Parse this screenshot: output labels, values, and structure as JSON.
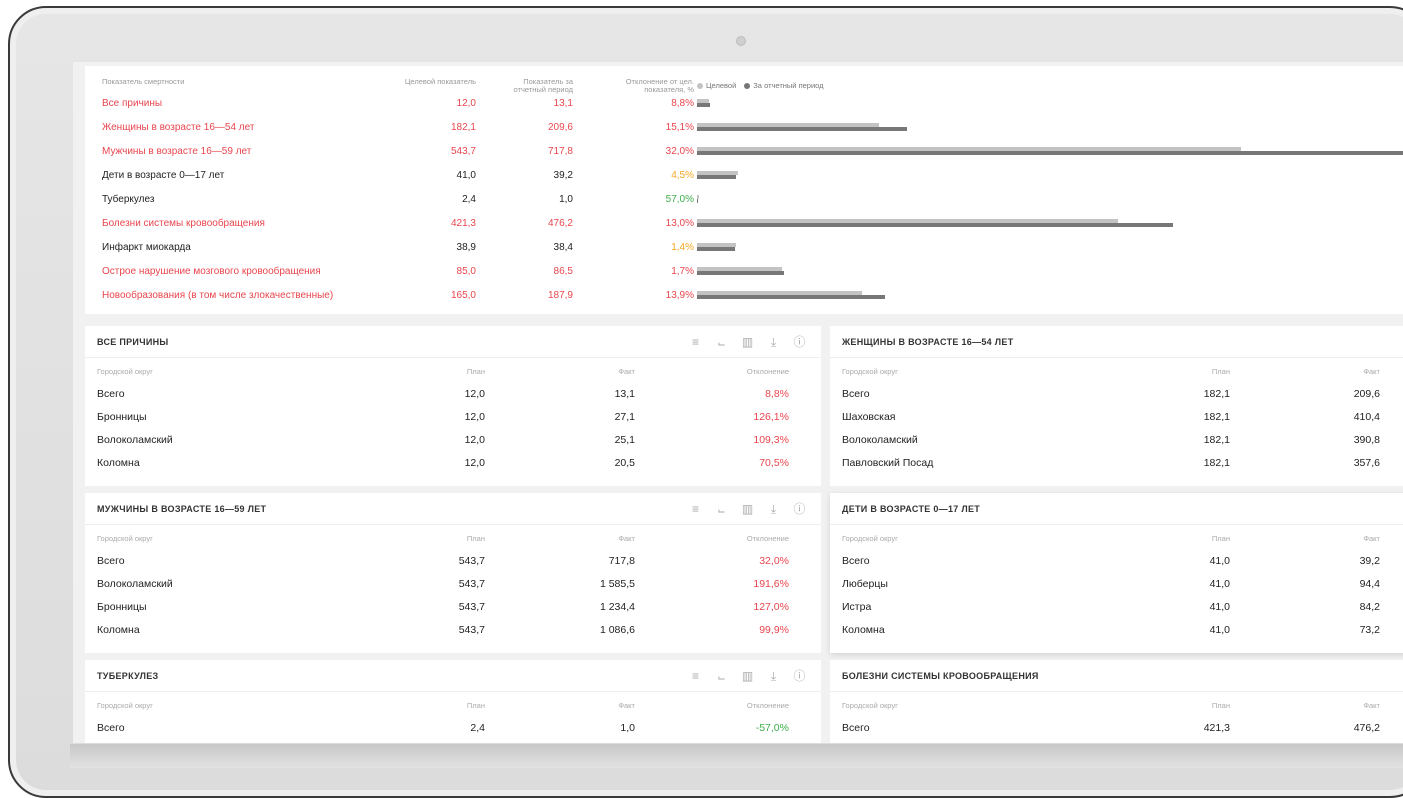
{
  "summary": {
    "headers": {
      "name": "Показатель смертности",
      "target": "Целевой показатель",
      "period": "Показатель за отчетный период",
      "deviation": "Отклонение от цел. показателя, %"
    },
    "legend": {
      "target": "Целевой",
      "period": "За отчетный период"
    },
    "rows": [
      {
        "name": "Все причины",
        "target": "12,0",
        "period": "13,1",
        "deviation": "8,8%",
        "target_value": 12.0,
        "period_value": 13.1
      },
      {
        "name": "Женщины в возрасте 16—54 лет",
        "target": "182,1",
        "period": "209,6",
        "deviation": "15,1%",
        "target_value": 182.1,
        "period_value": 209.6
      },
      {
        "name": "Мужчины в возрасте 16—59 лет",
        "target": "543,7",
        "period": "717,8",
        "deviation": "32,0%",
        "target_value": 543.7,
        "period_value": 717.8
      },
      {
        "name": "Дети в возрасте 0—17 лет",
        "target": "41,0",
        "period": "39,2",
        "deviation": "4,5%",
        "target_value": 41.0,
        "period_value": 39.2
      },
      {
        "name": "Туберкулез",
        "target": "2,4",
        "period": "1,0",
        "deviation": "57,0%",
        "target_value": 2.4,
        "period_value": 1.0
      },
      {
        "name": "Болезни системы кровообращения",
        "target": "421,3",
        "period": "476,2",
        "deviation": "13,0%",
        "target_value": 421.3,
        "period_value": 476.2
      },
      {
        "name": "Инфаркт миокарда",
        "target": "38,9",
        "period": "38,4",
        "deviation": "1,4%",
        "target_value": 38.9,
        "period_value": 38.4
      },
      {
        "name": "Острое нарушение мозгового кровообращения",
        "target": "85,0",
        "period": "86,5",
        "deviation": "1,7%",
        "target_value": 85.0,
        "period_value": 86.5
      },
      {
        "name": "Новообразования (в том числе злокачественные)",
        "target": "165,0",
        "period": "187,9",
        "deviation": "13,9%",
        "target_value": 165.0,
        "period_value": 187.9
      }
    ]
  },
  "colors": {
    "red": "#e8464e",
    "orange": "#f5a623",
    "green": "#3cae4a",
    "bar_target": "#c3c3c3",
    "bar_period": "#777777"
  },
  "icons": [
    "bar-chart-icon",
    "line-chart-icon",
    "map-icon",
    "download-icon",
    "info-icon"
  ],
  "cards": {
    "all_causes": {
      "title": "ВСЕ ПРИЧИНЫ",
      "headers": {
        "name": "Городской округ",
        "plan": "План",
        "fact": "Факт",
        "deviation": "Отклонение"
      },
      "rows": [
        {
          "name": "Всего",
          "plan": "12,0",
          "fact": "13,1",
          "deviation": "8,8%"
        },
        {
          "name": "Бронницы",
          "plan": "12,0",
          "fact": "27,1",
          "deviation": "126,1%"
        },
        {
          "name": "Волоколамский",
          "plan": "12,0",
          "fact": "25,1",
          "deviation": "109,3%"
        },
        {
          "name": "Коломна",
          "plan": "12,0",
          "fact": "20,5",
          "deviation": "70,5%"
        }
      ]
    },
    "women": {
      "title": "ЖЕНЩИНЫ В ВОЗРАСТЕ 16—54 ЛЕТ",
      "headers": {
        "name": "Городской округ",
        "plan": "План",
        "fact": "Факт"
      },
      "rows": [
        {
          "name": "Всего",
          "plan": "182,1",
          "fact": "209,6"
        },
        {
          "name": "Шаховская",
          "plan": "182,1",
          "fact": "410,4"
        },
        {
          "name": "Волоколамский",
          "plan": "182,1",
          "fact": "390,8"
        },
        {
          "name": "Павловский Посад",
          "plan": "182,1",
          "fact": "357,6"
        }
      ]
    },
    "men": {
      "title": "МУЖЧИНЫ В ВОЗРАСТЕ 16—59 ЛЕТ",
      "headers": {
        "name": "Городской округ",
        "plan": "План",
        "fact": "Факт",
        "deviation": "Отклонение"
      },
      "rows": [
        {
          "name": "Всего",
          "plan": "543,7",
          "fact": "717,8",
          "deviation": "32,0%"
        },
        {
          "name": "Волоколамский",
          "plan": "543,7",
          "fact": "1 585,5",
          "deviation": "191,6%"
        },
        {
          "name": "Бронницы",
          "plan": "543,7",
          "fact": "1 234,4",
          "deviation": "127,0%"
        },
        {
          "name": "Коломна",
          "plan": "543,7",
          "fact": "1 086,6",
          "deviation": "99,9%"
        }
      ]
    },
    "children": {
      "title": "ДЕТИ В ВОЗРАСТЕ 0—17 ЛЕТ",
      "headers": {
        "name": "Городской округ",
        "plan": "План",
        "fact": "Факт"
      },
      "rows": [
        {
          "name": "Всего",
          "plan": "41,0",
          "fact": "39,2"
        },
        {
          "name": "Люберцы",
          "plan": "41,0",
          "fact": "94,4"
        },
        {
          "name": "Истра",
          "plan": "41,0",
          "fact": "84,2"
        },
        {
          "name": "Коломна",
          "plan": "41,0",
          "fact": "73,2"
        }
      ]
    },
    "tuberculosis": {
      "title": "ТУБЕРКУЛЕЗ",
      "headers": {
        "name": "Городской округ",
        "plan": "План",
        "fact": "Факт",
        "deviation": "Отклонение"
      },
      "rows": [
        {
          "name": "Всего",
          "plan": "2,4",
          "fact": "1,0",
          "deviation": "-57,0%"
        }
      ]
    },
    "circulatory": {
      "title": "БОЛЕЗНИ СИСТЕМЫ КРОВООБРАЩЕНИЯ",
      "headers": {
        "name": "Городской округ",
        "plan": "План",
        "fact": "Факт"
      },
      "rows": [
        {
          "name": "Всего",
          "plan": "421,3",
          "fact": "476,2"
        }
      ]
    }
  }
}
